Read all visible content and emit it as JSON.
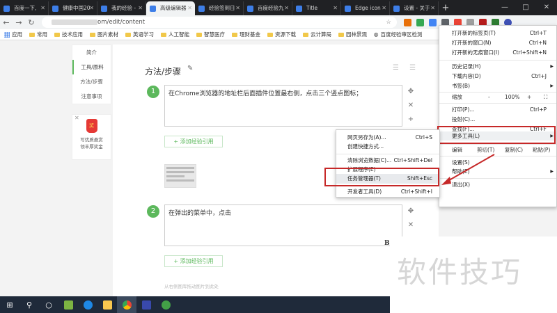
{
  "tabs": [
    {
      "title": "百度一下,",
      "active": false
    },
    {
      "title": "健康中国20",
      "active": false
    },
    {
      "title": "我的经验 -",
      "active": false
    },
    {
      "title": "高级编辑器",
      "active": true
    },
    {
      "title": "经验签到日",
      "active": false
    },
    {
      "title": "百度经验九",
      "active": false
    },
    {
      "title": "Title",
      "active": false
    },
    {
      "title": "Edge icon",
      "active": false
    },
    {
      "title": "设置 - 关于",
      "active": false
    }
  ],
  "window_controls": {
    "minimize": "—",
    "maximize": "□",
    "close": "✕"
  },
  "toolbar": {
    "back": "←",
    "forward": "→",
    "reload": "↻",
    "new_tab": "+",
    "url_visible": "om/edit/content",
    "star": "☆"
  },
  "bookmarks": [
    {
      "label": "应用",
      "icon": "apps"
    },
    {
      "label": "常用",
      "icon": "folder"
    },
    {
      "label": "技术应用",
      "icon": "folder"
    },
    {
      "label": "图片素材",
      "icon": "folder"
    },
    {
      "label": "英语学习",
      "icon": "folder"
    },
    {
      "label": "人工智能",
      "icon": "folder"
    },
    {
      "label": "智慧医疗",
      "icon": "folder"
    },
    {
      "label": "理财基金",
      "icon": "folder"
    },
    {
      "label": "资源下载",
      "icon": "folder"
    },
    {
      "label": "云计算局",
      "icon": "folder"
    },
    {
      "label": "园林景观",
      "icon": "folder"
    },
    {
      "label": "百度经验审区检测",
      "icon": "globe"
    }
  ],
  "left_nav": {
    "items": [
      {
        "label": "简介",
        "active": false
      },
      {
        "label": "工具/原料",
        "active": true
      },
      {
        "label": "方法/步骤",
        "active": false
      },
      {
        "label": "注意事项",
        "active": false
      }
    ]
  },
  "reward": {
    "close": "✕",
    "badge": "奖",
    "line1": "写优质悬赏",
    "line2": "领丰厚奖金"
  },
  "editor": {
    "section_title": "方法/步骤",
    "pen": "✎",
    "list_icons": "☰ ☰",
    "steps": [
      {
        "number": "1",
        "text": "在Chrome浏览器的地址栏后面插件位置最右侧，点击三个竖点图标；"
      },
      {
        "number": "2",
        "text": "在弹出的菜单中，点击"
      }
    ],
    "add_button": "+ 添加经验引用",
    "side_icons": {
      "move": "✥",
      "close": "✕",
      "add": "+"
    },
    "bold_b": "B",
    "hint": "从右侧图库拖动图片到此处"
  },
  "chrome_menu": {
    "new_tab": {
      "label": "打开新的标签页(T)",
      "shortcut": "Ctrl+T"
    },
    "new_window": {
      "label": "打开新的窗口(N)",
      "shortcut": "Ctrl+N"
    },
    "incognito": {
      "label": "打开新的无痕窗口(I)",
      "shortcut": "Ctrl+Shift+N"
    },
    "history": {
      "label": "历史记录(H)"
    },
    "downloads": {
      "label": "下载内容(D)",
      "shortcut": "Ctrl+J"
    },
    "bookmarks": {
      "label": "书签(B)"
    },
    "zoom": {
      "label": "缩放",
      "minus": "-",
      "value": "100%",
      "plus": "+",
      "full": "⛶"
    },
    "print": {
      "label": "打印(P)...",
      "shortcut": "Ctrl+P"
    },
    "cast": {
      "label": "投射(C)..."
    },
    "find": {
      "label": "查找(F)...",
      "shortcut": "Ctrl+F"
    },
    "more_tools": {
      "label": "更多工具(L)"
    },
    "edit": {
      "label": "编辑",
      "cut": "剪切(T)",
      "copy": "复制(C)",
      "paste": "粘贴(P)"
    },
    "settings": {
      "label": "设置(S)"
    },
    "help": {
      "label": "帮助(E)"
    },
    "exit": {
      "label": "退出(X)"
    }
  },
  "more_tools_menu": {
    "save_page": {
      "label": "网页另存为(A)...",
      "shortcut": "Ctrl+S"
    },
    "create_shortcut": {
      "label": "创建快捷方式..."
    },
    "clear_data": {
      "label": "清除浏览数据(C)...",
      "shortcut": "Ctrl+Shift+Del"
    },
    "extensions": {
      "label": "扩展程序(E)"
    },
    "task_manager": {
      "label": "任务管理器(T)",
      "shortcut": "Shift+Esc"
    },
    "devtools": {
      "label": "开发者工具(D)",
      "shortcut": "Ctrl+Shift+I"
    }
  },
  "watermark": {
    "text": "软件技巧"
  },
  "taskbar": {
    "start": "⊞",
    "search": "⚲",
    "taskview": "○"
  },
  "colors": {
    "accent_green": "#5cb85c",
    "highlight_red": "#c62828",
    "tabstrip": "#202124",
    "taskbar": "#1f2a3a"
  }
}
